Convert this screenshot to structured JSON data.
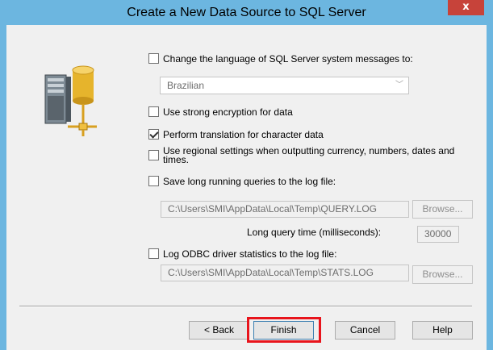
{
  "window": {
    "title": "Create a New Data Source to SQL Server",
    "close_glyph": "x"
  },
  "options": {
    "change_language": {
      "label": "Change the language of SQL Server system messages to:",
      "checked": false
    },
    "language_select": {
      "value": "Brazilian"
    },
    "strong_encryption": {
      "label": "Use strong encryption for data",
      "checked": false
    },
    "translation": {
      "label": "Perform translation for character data",
      "checked": true
    },
    "regional_line1": "Use regional settings when outputting currency, numbers, dates and",
    "regional_line2": "times.",
    "regional_checked": false,
    "long_queries": {
      "label": "Save long running queries to the log file:",
      "checked": false
    },
    "query_log_path": "C:\\Users\\SMI\\AppData\\Local\\Temp\\QUERY.LOG",
    "long_query_time_label": "Long query time (milliseconds):",
    "long_query_time_value": "30000",
    "odbc_stats": {
      "label": "Log ODBC driver statistics to the log file:",
      "checked": false
    },
    "stats_log_path": "C:\\Users\\SMI\\AppData\\Local\\Temp\\STATS.LOG"
  },
  "buttons": {
    "browse1": "Browse...",
    "browse2": "Browse...",
    "back": "< Back",
    "finish": "Finish",
    "cancel": "Cancel",
    "help": "Help"
  },
  "icons": {
    "server": "database-server-icon"
  },
  "colors": {
    "titlebar": "#6cb6e0",
    "close": "#c7433a",
    "highlight": "#e8141c"
  }
}
